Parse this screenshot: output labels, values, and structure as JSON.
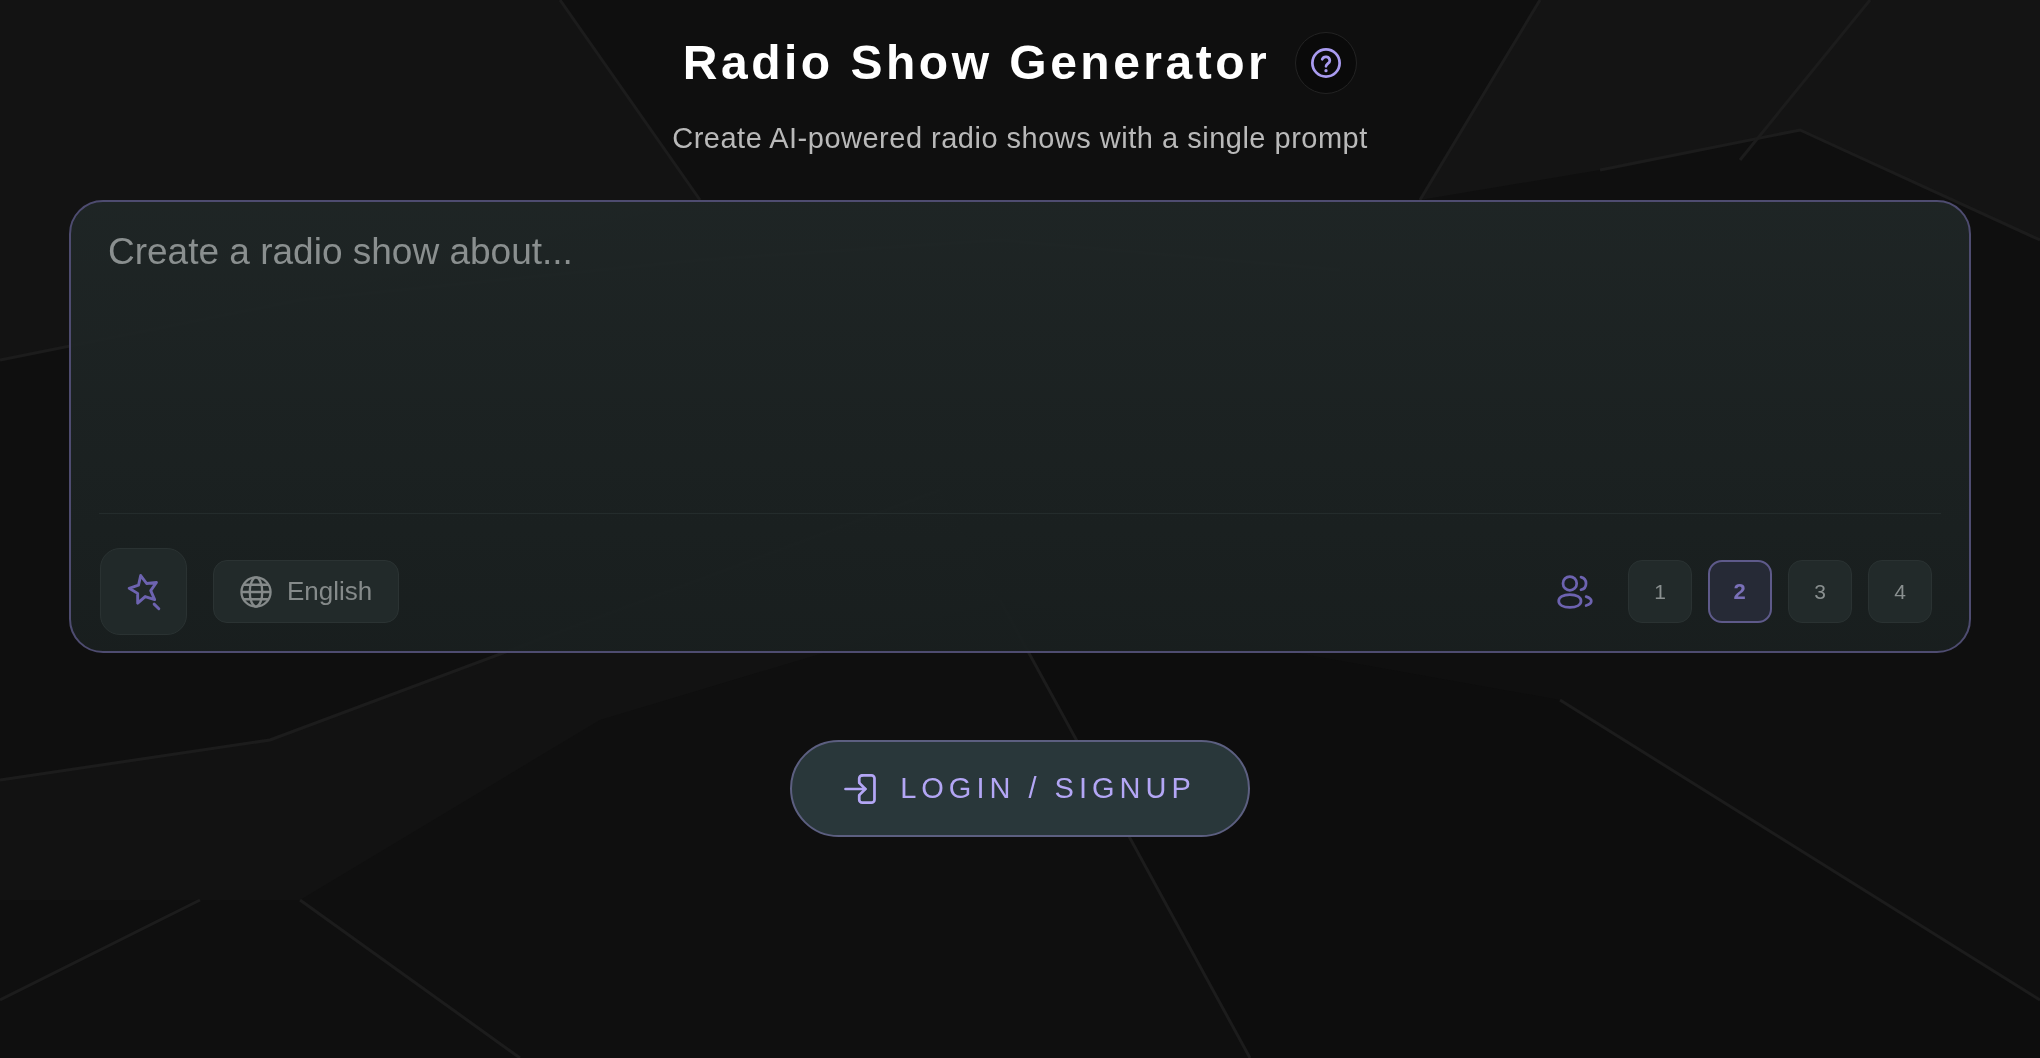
{
  "header": {
    "title": "Radio Show Generator",
    "subtitle": "Create AI-powered radio shows with a single prompt"
  },
  "prompt": {
    "placeholder": "Create a radio show about...",
    "language": "English",
    "speakers": [
      {
        "label": "1",
        "selected": false
      },
      {
        "label": "2",
        "selected": true
      },
      {
        "label": "3",
        "selected": false
      },
      {
        "label": "4",
        "selected": false
      }
    ]
  },
  "login_button": {
    "label": "LOGIN / SIGNUP"
  }
}
